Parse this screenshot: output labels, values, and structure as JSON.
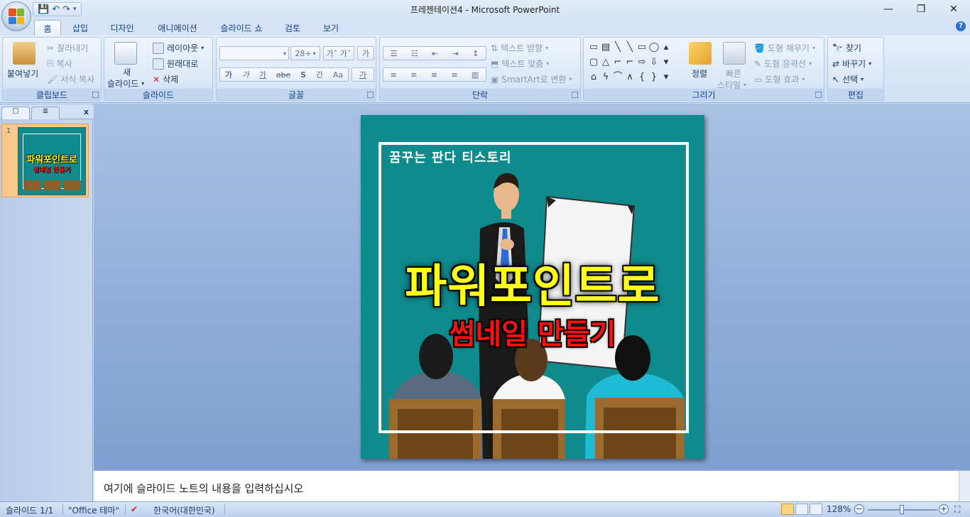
{
  "window": {
    "title": "프레젠테이션4 - Microsoft PowerPoint",
    "controls": [
      "—",
      "❐",
      "✕"
    ]
  },
  "qat_icons": [
    "save-icon",
    "undo-icon",
    "redo-icon",
    "customize-icon"
  ],
  "tabs": [
    {
      "label": "홈",
      "active": true
    },
    {
      "label": "삽입"
    },
    {
      "label": "디자인"
    },
    {
      "label": "애니메이션"
    },
    {
      "label": "슬라이드 쇼"
    },
    {
      "label": "검토"
    },
    {
      "label": "보기"
    }
  ],
  "ribbon": {
    "clipboard": {
      "label": "클립보드",
      "paste": "붙여넣기",
      "cut": "잘라내기",
      "copy": "복사",
      "format_painter": "서식 복사"
    },
    "slides": {
      "label": "슬라이드",
      "new_slide_line1": "새",
      "new_slide_line2": "슬라이드",
      "layout": "레이아웃",
      "reset": "원래대로",
      "delete": "삭제"
    },
    "font": {
      "label": "글꼴",
      "size": "28+",
      "buttons": [
        "가",
        "가",
        "가",
        "abe",
        "S",
        "간",
        "Aa",
        "가"
      ]
    },
    "paragraph": {
      "label": "단락",
      "text_direction": "텍스트 방향",
      "align_text": "텍스트 맞춤",
      "smartart": "SmartArt로 변환"
    },
    "drawing": {
      "label": "그리기",
      "arrange": "정렬",
      "quick_styles_line1": "빠른",
      "quick_styles_line2": "스타일",
      "shape_fill": "도형 채우기",
      "shape_outline": "도형 윤곽선",
      "shape_effects": "도형 효과"
    },
    "editing": {
      "label": "편집",
      "find": "찾기",
      "replace": "바꾸기",
      "select": "선택"
    }
  },
  "slide_pane": {
    "thumbnail_number": "1",
    "close": "x"
  },
  "slide": {
    "caption": "꿈꾸는 판다 티스토리",
    "title": "파워포인트로",
    "subtitle": "썸네일 만들기",
    "background_color": "#0f8b8d",
    "title_color": "#ffff1a",
    "subtitle_color": "#ff1010"
  },
  "notes": {
    "placeholder": "여기에 슬라이드 노트의 내용을 입력하십시오"
  },
  "status": {
    "slide_count": "슬라이드 1/1",
    "theme": "\"Office 테마\"",
    "language": "한국어(대한민국)",
    "zoom": "128%"
  }
}
